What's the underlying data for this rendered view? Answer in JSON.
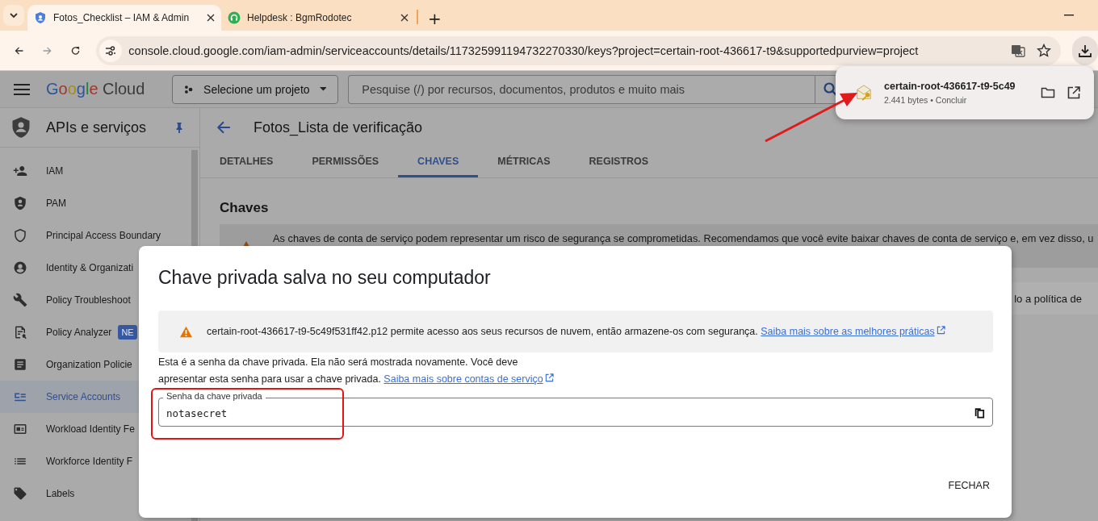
{
  "browser": {
    "tabs": [
      {
        "title": "Fotos_Checklist – IAM & Admin",
        "selected": true
      },
      {
        "title": "Helpdesk : BgmRodotec",
        "selected": false
      }
    ],
    "new_tab": "+",
    "url": "console.cloud.google.com/iam-admin/serviceaccounts/details/117325991194732270330/keys?project=certain-root-436617-t9&supportedpurview=project"
  },
  "download": {
    "file": "certain-root-436617-t9-5c49",
    "status": "2.441 bytes • Concluir"
  },
  "header": {
    "logo_brand": "Google",
    "logo_product": "Cloud",
    "project_picker": "Selecione um projeto",
    "search": {
      "placeholder": "Pesquise (/) por recursos, documentos, produtos e muito mais"
    }
  },
  "sidebar": {
    "title": "APIs e serviços",
    "items": [
      {
        "label": "IAM",
        "selected": false
      },
      {
        "label": "PAM",
        "selected": false
      },
      {
        "label": "Principal Access Boundary",
        "selected": false
      },
      {
        "label": "Identity & Organizati",
        "selected": false
      },
      {
        "label": "Policy Troubleshoot",
        "selected": false
      },
      {
        "label": "Policy Analyzer",
        "selected": false,
        "badge": "NE"
      },
      {
        "label": "Organization Policie",
        "selected": false
      },
      {
        "label": "Service Accounts",
        "selected": true
      },
      {
        "label": "Workload Identity Fe",
        "selected": false
      },
      {
        "label": "Workforce Identity F",
        "selected": false
      },
      {
        "label": "Labels",
        "selected": false
      }
    ]
  },
  "page": {
    "title": "Fotos_Lista de verificação",
    "tabs": [
      {
        "label": "DETALHES",
        "selected": false
      },
      {
        "label": "PERMISSÕES",
        "selected": false
      },
      {
        "label": "CHAVES",
        "selected": true
      },
      {
        "label": "MÉTRICAS",
        "selected": false
      },
      {
        "label": "REGISTROS",
        "selected": false
      }
    ],
    "section": "Chaves",
    "banner": "As chaves de conta de serviço podem representar um risco de segurança se comprometidas. Recomendamos que você evite baixar chaves de conta de serviço e, em vez disso, u",
    "banner_2": "lo a política de"
  },
  "dialog": {
    "title": "Chave privada salva no seu computador",
    "warning": {
      "text": "certain-root-436617-t9-5c49f531ff42.p12 permite acesso aos seus recursos de nuvem, então armazene-os com segurança.",
      "link": "Saiba mais sobre as melhores práticas"
    },
    "info": {
      "text": "Esta é a senha da chave privada. Ela não será mostrada novamente. Você deve apresentar esta senha para usar a chave privada.",
      "link": "Saiba mais sobre contas de serviço"
    },
    "field": {
      "label": "Senha da chave privada",
      "value": "notasecret"
    },
    "button": "FECHAR"
  }
}
